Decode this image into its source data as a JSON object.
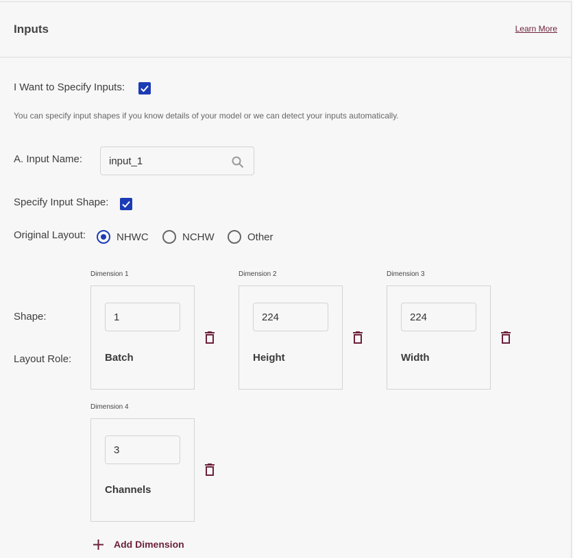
{
  "header": {
    "title": "Inputs",
    "learn_more": "Learn More"
  },
  "specify_inputs": {
    "label": "I Want to Specify Inputs:",
    "checked": true
  },
  "hint": "You can specify input shapes if you know details of your model or we can detect your inputs automatically.",
  "input_name": {
    "label": "A. Input Name:",
    "value": "input_1",
    "icon": "search-icon"
  },
  "specify_shape": {
    "label": "Specify Input Shape:",
    "checked": true
  },
  "original_layout": {
    "label": "Original Layout:",
    "options": [
      "NHWC",
      "NCHW",
      "Other"
    ],
    "selected": "NHWC"
  },
  "row_labels": {
    "shape": "Shape:",
    "layout_role": "Layout Role:"
  },
  "dimensions": [
    {
      "caption": "Dimension 1",
      "value": "1",
      "role": "Batch"
    },
    {
      "caption": "Dimension 2",
      "value": "224",
      "role": "Height"
    },
    {
      "caption": "Dimension 3",
      "value": "224",
      "role": "Width"
    },
    {
      "caption": "Dimension 4",
      "value": "3",
      "role": "Channels"
    }
  ],
  "add_dimension": "Add Dimension",
  "colors": {
    "accent": "#1d3bb5",
    "brand": "#6b1f3b",
    "background": "#f7f7f7"
  }
}
